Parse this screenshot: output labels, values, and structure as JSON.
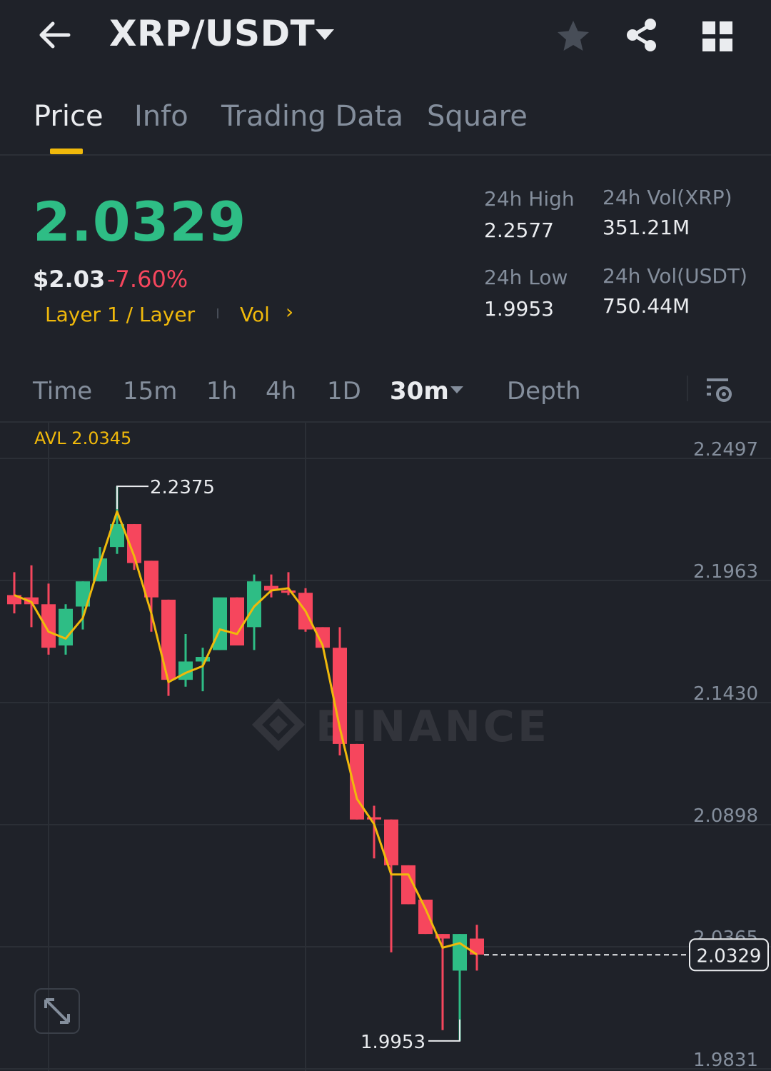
{
  "header": {
    "pair": "XRP/USDT",
    "icons": [
      "back-arrow-icon",
      "caret-down-icon",
      "star-icon",
      "share-icon",
      "grid-icon"
    ]
  },
  "tabs": [
    {
      "label": "Price",
      "active": true
    },
    {
      "label": "Info",
      "active": false
    },
    {
      "label": "Trading Data",
      "active": false
    },
    {
      "label": "Square",
      "active": false
    }
  ],
  "price": {
    "last": "2.0329",
    "usd": "$2.03",
    "change": "-7.60%",
    "tag": "Layer 1 / Layer",
    "vol_link": "Vol",
    "vol_chevron": "›"
  },
  "stats": {
    "high_label": "24h High",
    "high": "2.2577",
    "low_label": "24h Low",
    "low": "1.9953",
    "vol_base_label": "24h Vol(XRP)",
    "vol_base": "351.21M",
    "vol_quote_label": "24h Vol(USDT)",
    "vol_quote": "750.44M"
  },
  "timeframes": {
    "items": [
      "Time",
      "15m",
      "1h",
      "4h",
      "1D"
    ],
    "selected": "30m",
    "depth": "Depth"
  },
  "colors": {
    "up": "#2ebd85",
    "down": "#f6465d",
    "accent": "#f0b90b",
    "background": "#1f2229"
  },
  "chart_data": {
    "type": "candlestick",
    "indicator_label": "AVL 2.0345",
    "y_ticks": [
      "2.2497",
      "2.1963",
      "2.1430",
      "2.0898",
      "2.0365",
      "1.9831"
    ],
    "ylim": [
      1.9831,
      2.2497
    ],
    "high_marker": "2.2375",
    "low_marker": "1.9953",
    "last_price_tag": "2.0329",
    "watermark": "BINANCE",
    "candles": [
      {
        "o": 2.19,
        "h": 2.2,
        "c": 2.186,
        "l": 2.182
      },
      {
        "o": 2.189,
        "h": 2.203,
        "c": 2.186,
        "l": 2.176
      },
      {
        "o": 2.186,
        "h": 2.195,
        "c": 2.167,
        "l": 2.164
      },
      {
        "o": 2.168,
        "h": 2.186,
        "c": 2.184,
        "l": 2.164
      },
      {
        "o": 2.185,
        "h": 2.196,
        "c": 2.196,
        "l": 2.175
      },
      {
        "o": 2.196,
        "h": 2.211,
        "c": 2.206,
        "l": 2.196
      },
      {
        "o": 2.211,
        "h": 2.2375,
        "c": 2.221,
        "l": 2.208
      },
      {
        "o": 2.221,
        "h": 2.221,
        "c": 2.204,
        "l": 2.201
      },
      {
        "o": 2.205,
        "h": 2.205,
        "c": 2.189,
        "l": 2.174
      },
      {
        "o": 2.188,
        "h": 2.188,
        "c": 2.153,
        "l": 2.146
      },
      {
        "o": 2.153,
        "h": 2.173,
        "c": 2.161,
        "l": 2.15
      },
      {
        "o": 2.161,
        "h": 2.167,
        "c": 2.163,
        "l": 2.148
      },
      {
        "o": 2.166,
        "h": 2.188,
        "c": 2.189,
        "l": 2.166
      },
      {
        "o": 2.189,
        "h": 2.189,
        "c": 2.168,
        "l": 2.168
      },
      {
        "o": 2.176,
        "h": 2.199,
        "c": 2.196,
        "l": 2.166
      },
      {
        "o": 2.194,
        "h": 2.199,
        "c": 2.192,
        "l": 2.189
      },
      {
        "o": 2.192,
        "h": 2.2,
        "c": 2.191,
        "l": 2.19
      },
      {
        "o": 2.191,
        "h": 2.193,
        "c": 2.175,
        "l": 2.174
      },
      {
        "o": 2.176,
        "h": 2.176,
        "c": 2.167,
        "l": 2.167
      },
      {
        "o": 2.167,
        "h": 2.176,
        "c": 2.125,
        "l": 2.12
      },
      {
        "o": 2.125,
        "h": 2.125,
        "c": 2.092,
        "l": 2.092
      },
      {
        "o": 2.093,
        "h": 2.098,
        "c": 2.092,
        "l": 2.075
      },
      {
        "o": 2.092,
        "h": 2.092,
        "c": 2.072,
        "l": 2.034
      },
      {
        "o": 2.072,
        "h": 2.072,
        "c": 2.055,
        "l": 2.055
      },
      {
        "o": 2.057,
        "h": 2.057,
        "c": 2.042,
        "l": 2.042
      },
      {
        "o": 2.042,
        "h": 2.042,
        "c": 2.04,
        "l": 2.0
      },
      {
        "o": 2.026,
        "h": 2.042,
        "c": 2.042,
        "l": 1.9953
      },
      {
        "o": 2.04,
        "h": 2.046,
        "c": 2.033,
        "l": 2.026
      }
    ],
    "avg_line": [
      2.19,
      2.187,
      2.174,
      2.171,
      2.18,
      2.204,
      2.2265,
      2.207,
      2.182,
      2.152,
      2.156,
      2.159,
      2.175,
      2.173,
      2.185,
      2.192,
      2.193,
      2.183,
      2.168,
      2.132,
      2.101,
      2.09,
      2.068,
      2.068,
      2.053,
      2.036,
      2.038,
      2.033
    ]
  }
}
